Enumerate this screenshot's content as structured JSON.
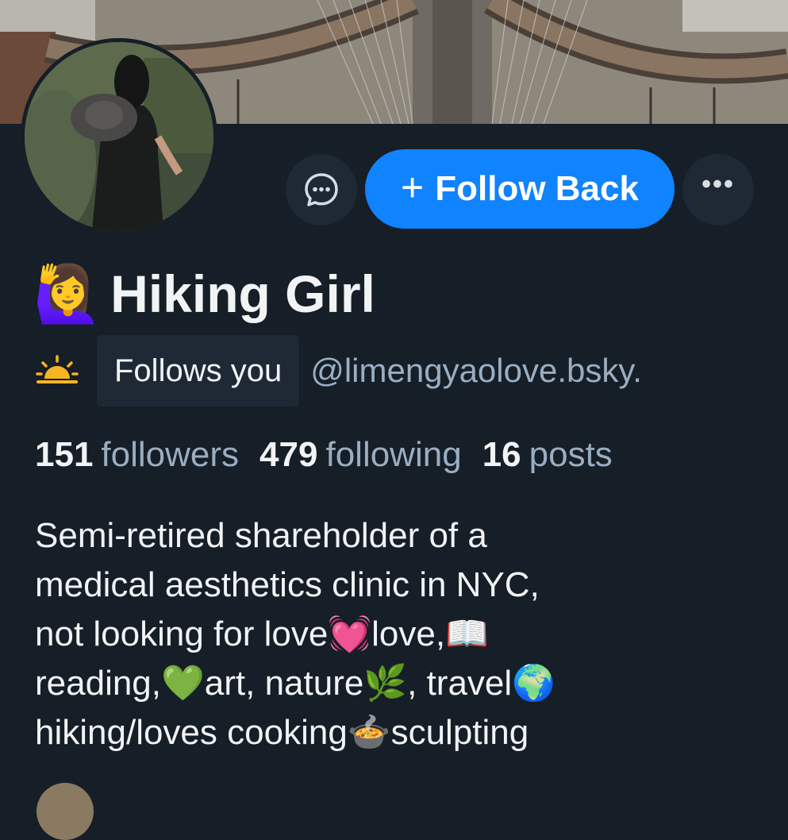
{
  "profile": {
    "name_emoji": "🙋‍♀️",
    "display_name": "Hiking Girl",
    "follows_badge": "Follows you",
    "handle": "@limengyaolove.bsky.",
    "follow_button": "Follow Back",
    "follow_icon": "plus-icon",
    "message_icon": "chat-bubble-icon",
    "more_icon": "ellipsis-icon",
    "more_label": "•••",
    "status_icon": "sunrise-icon"
  },
  "stats": {
    "followers_count": "151",
    "followers_label": "followers",
    "following_count": "479",
    "following_label": "following",
    "posts_count": "16",
    "posts_label": "posts"
  },
  "bio": {
    "lines": [
      "Semi-retired shareholder of a",
      "medical aesthetics clinic in NYC,",
      "not looking for love💓love,📖",
      "reading,💚art, nature🌿, travel🌍",
      "hiking/loves cooking🍲sculpting"
    ]
  },
  "colors": {
    "background": "#161e27",
    "accent": "#1083fe",
    "muted_text": "#9aaec2",
    "chip_bg": "#1e2935"
  }
}
